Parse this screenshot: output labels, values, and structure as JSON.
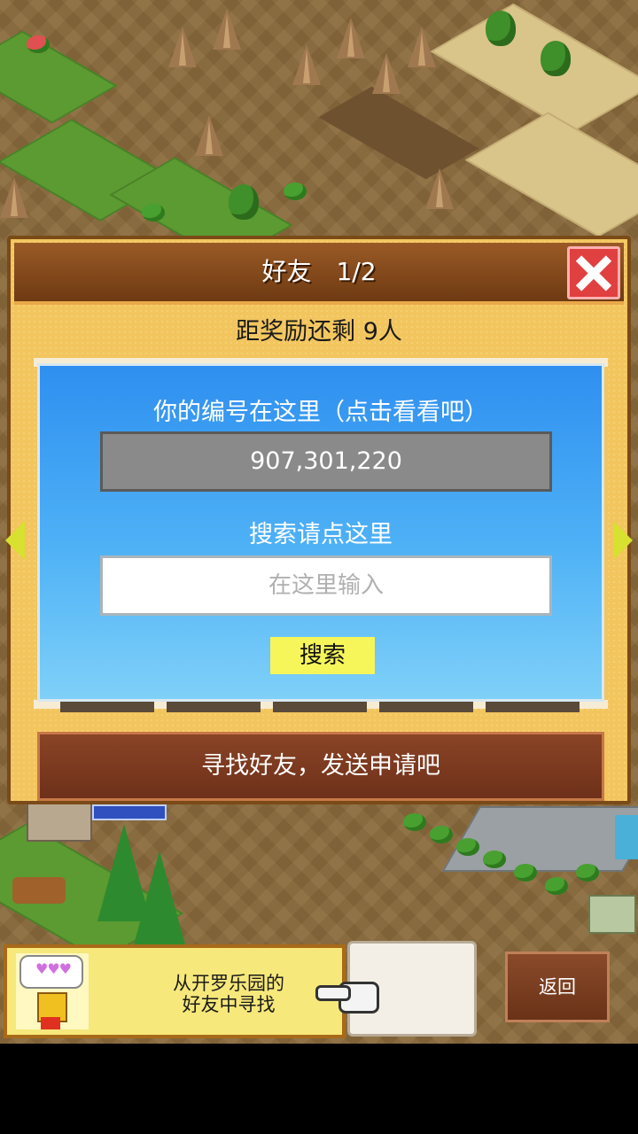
{
  "dialog": {
    "title": "好友　1/2",
    "reward_remaining": "距奖励还剩 9人",
    "id_label": "你的编号在这里（点击看看吧）",
    "player_id": "907,301,220",
    "search_label": "搜索请点这里",
    "search_placeholder": "在这里输入",
    "search_button": "搜索",
    "find_friends": "寻找好友，发送申请吧"
  },
  "bottom": {
    "kairo_line1": "从开罗乐园的",
    "kairo_line2": "好友中寻找",
    "back_button": "返回"
  },
  "colors": {
    "dialog_bg": "#f2c55e",
    "title_bar": "#7a4216",
    "panel_blue": "#3a9ef2",
    "close_red": "#e04040",
    "search_button": "#f6f65a"
  },
  "icons": [
    "close-icon",
    "arrow-left-icon",
    "arrow-right-icon",
    "pointing-hand-icon",
    "robot-mascot-icon",
    "hearts-icon"
  ]
}
